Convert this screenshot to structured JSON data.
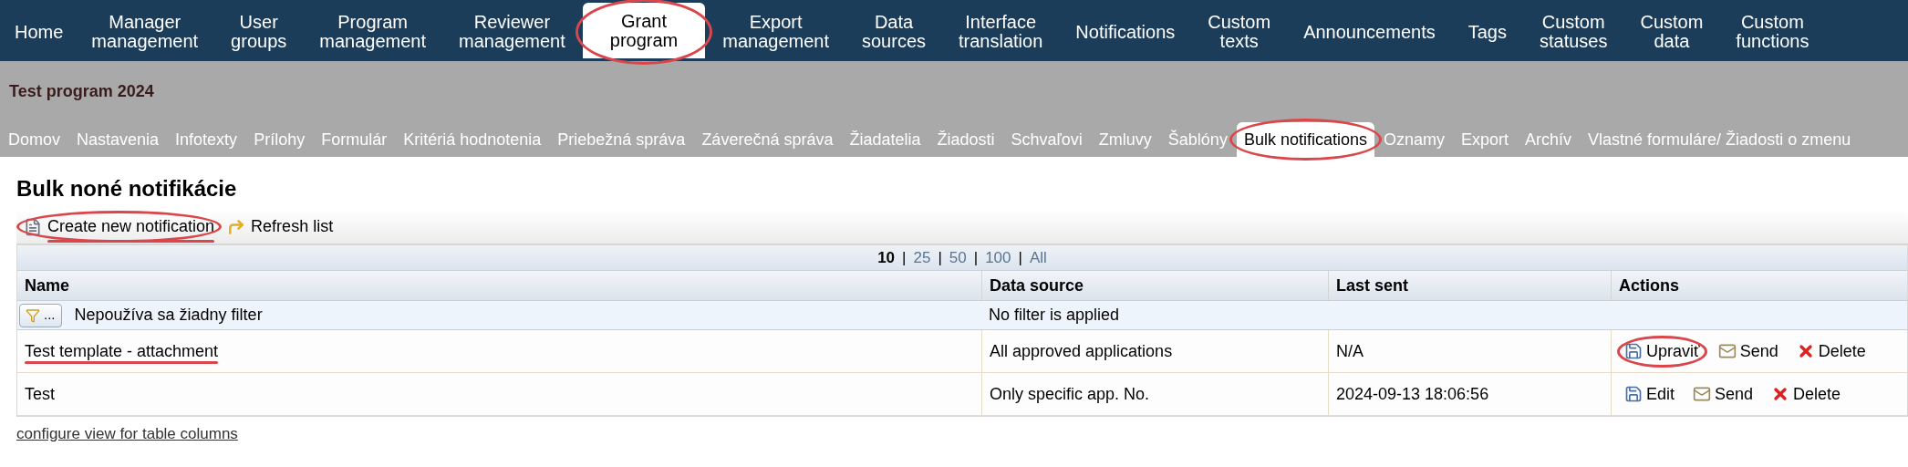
{
  "top_nav": [
    {
      "label": "Home",
      "selected": false,
      "highlighted": false
    },
    {
      "label": "Manager management",
      "selected": false,
      "highlighted": false
    },
    {
      "label": "User groups",
      "selected": false,
      "highlighted": false
    },
    {
      "label": "Program management",
      "selected": false,
      "highlighted": false
    },
    {
      "label": "Reviewer management",
      "selected": false,
      "highlighted": false
    },
    {
      "label": "Grant program",
      "selected": true,
      "highlighted": true
    },
    {
      "label": "Export management",
      "selected": false,
      "highlighted": false
    },
    {
      "label": "Data sources",
      "selected": false,
      "highlighted": false
    },
    {
      "label": "Interface translation",
      "selected": false,
      "highlighted": false
    },
    {
      "label": "Notifications",
      "selected": false,
      "highlighted": false
    },
    {
      "label": "Custom texts",
      "selected": false,
      "highlighted": false
    },
    {
      "label": "Announcements",
      "selected": false,
      "highlighted": false
    },
    {
      "label": "Tags",
      "selected": false,
      "highlighted": false
    },
    {
      "label": "Custom statuses",
      "selected": false,
      "highlighted": false
    },
    {
      "label": "Custom data",
      "selected": false,
      "highlighted": false
    },
    {
      "label": "Custom functions",
      "selected": false,
      "highlighted": false
    }
  ],
  "program_title": "Test program 2024",
  "sub_nav": [
    {
      "label": "Domov",
      "selected": false,
      "highlighted": false
    },
    {
      "label": "Nastavenia",
      "selected": false,
      "highlighted": false
    },
    {
      "label": "Infotexty",
      "selected": false,
      "highlighted": false
    },
    {
      "label": "Prílohy",
      "selected": false,
      "highlighted": false
    },
    {
      "label": "Formulár",
      "selected": false,
      "highlighted": false
    },
    {
      "label": "Kritériá hodnotenia",
      "selected": false,
      "highlighted": false
    },
    {
      "label": "Priebežná správa",
      "selected": false,
      "highlighted": false
    },
    {
      "label": "Záverečná správa",
      "selected": false,
      "highlighted": false
    },
    {
      "label": "Žiadatelia",
      "selected": false,
      "highlighted": false
    },
    {
      "label": "Žiadosti",
      "selected": false,
      "highlighted": false
    },
    {
      "label": "Schvaľovi",
      "selected": false,
      "highlighted": false
    },
    {
      "label": "Zmluvy",
      "selected": false,
      "highlighted": false
    },
    {
      "label": "Šablóny",
      "selected": false,
      "highlighted": false
    },
    {
      "label": "Bulk notifications",
      "selected": true,
      "highlighted": true
    },
    {
      "label": "Oznamy",
      "selected": false,
      "highlighted": false
    },
    {
      "label": "Export",
      "selected": false,
      "highlighted": false
    },
    {
      "label": "Archív",
      "selected": false,
      "highlighted": false
    },
    {
      "label": "Vlastné formuláre/ Žiadosti o zmenu",
      "selected": false,
      "highlighted": false
    }
  ],
  "heading": "Bulk noné notifikácie",
  "toolbar": [
    {
      "kind": "create",
      "label": "Create new notification",
      "highlighted": true,
      "underlined": true
    },
    {
      "kind": "refresh",
      "label": "Refresh list",
      "highlighted": false,
      "underlined": false
    }
  ],
  "pager_separator": "|",
  "pager": [
    {
      "label": "10",
      "selected": true
    },
    {
      "label": "25",
      "selected": false
    },
    {
      "label": "50",
      "selected": false
    },
    {
      "label": "100",
      "selected": false
    },
    {
      "label": "All",
      "selected": false
    }
  ],
  "table": {
    "columns": [
      "Name",
      "Data source",
      "Last sent",
      "Actions"
    ],
    "filter_row": {
      "button": "...",
      "name": "Nepoužíva sa žiadny filter",
      "data_source": "No filter is applied"
    },
    "rows": [
      {
        "name": "Test template - attachment",
        "name_underlined": true,
        "data_source": "All approved applications",
        "last_sent": "N/A",
        "actions": [
          {
            "kind": "edit",
            "label": "Upraviť",
            "highlighted": true
          },
          {
            "kind": "send",
            "label": "Send",
            "highlighted": false
          },
          {
            "kind": "delete",
            "label": "Delete",
            "highlighted": false
          }
        ]
      },
      {
        "name": "Test",
        "name_underlined": false,
        "data_source": "Only specific app. No.",
        "last_sent": "2024-09-13 18:06:56",
        "actions": [
          {
            "kind": "edit",
            "label": "Edit",
            "highlighted": false
          },
          {
            "kind": "send",
            "label": "Send",
            "highlighted": false
          },
          {
            "kind": "delete",
            "label": "Delete",
            "highlighted": false
          }
        ]
      }
    ]
  },
  "footer_link": "configure view for table columns"
}
